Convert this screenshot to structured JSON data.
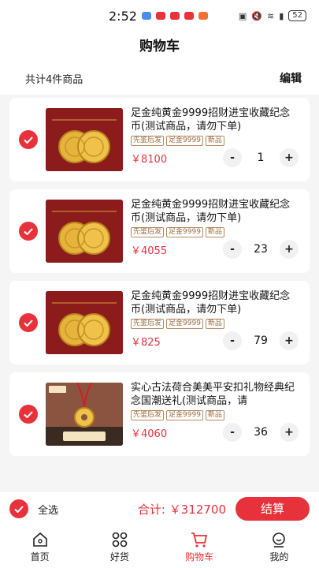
{
  "status": {
    "time": "2:52",
    "battery": "52",
    "notif_colors": [
      "#4a8cf0",
      "#e8323b",
      "#e8323b",
      "#e8323b",
      "#f07030"
    ]
  },
  "header": {
    "title": "购物车"
  },
  "summary": {
    "count_text": "共计4件商品",
    "edit_label": "编辑"
  },
  "items": [
    {
      "name": "足金纯黄金9999招财进宝收藏纪念币(测试商品，请勿下单)",
      "tags": [
        "先鉴后发",
        "足金9999",
        "新品"
      ],
      "price": "￥8100",
      "qty": "1",
      "image": "gold-coin-product-image"
    },
    {
      "name": "足金纯黄金9999招财进宝收藏纪念币(测试商品，请勿下单)",
      "tags": [
        "先鉴后发",
        "足金9999",
        "新品"
      ],
      "price": "￥4055",
      "qty": "23",
      "image": "gold-coin-product-image"
    },
    {
      "name": "足金纯黄金9999招财进宝收藏纪念币(测试商品，请勿下单)",
      "tags": [
        "先鉴后发",
        "足金9999",
        "新品"
      ],
      "price": "￥825",
      "qty": "79",
      "image": "gold-coin-product-image"
    },
    {
      "name": "实心古法荷合美美平安扣礼物经典纪念国潮送礼(测试商品，请",
      "tags": [
        "先鉴后发",
        "足金9999",
        "新品"
      ],
      "price": "￥4060",
      "qty": "36",
      "image": "safety-buckle-product-image"
    }
  ],
  "stepper": {
    "minus": "-",
    "plus": "+"
  },
  "footer": {
    "select_all": "全选",
    "total": "合计: ￥312700",
    "checkout": "结算"
  },
  "tabs": [
    {
      "label": "首页",
      "icon": "home-icon",
      "active": false
    },
    {
      "label": "好货",
      "icon": "grid-icon",
      "active": false
    },
    {
      "label": "购物车",
      "icon": "cart-icon",
      "active": true
    },
    {
      "label": "我的",
      "icon": "profile-icon",
      "active": false
    }
  ],
  "colors": {
    "accent": "#e8323b",
    "tag_border": "#b48a62",
    "thumb_red": "#8c1c1c",
    "gold": "#e6b43a"
  }
}
